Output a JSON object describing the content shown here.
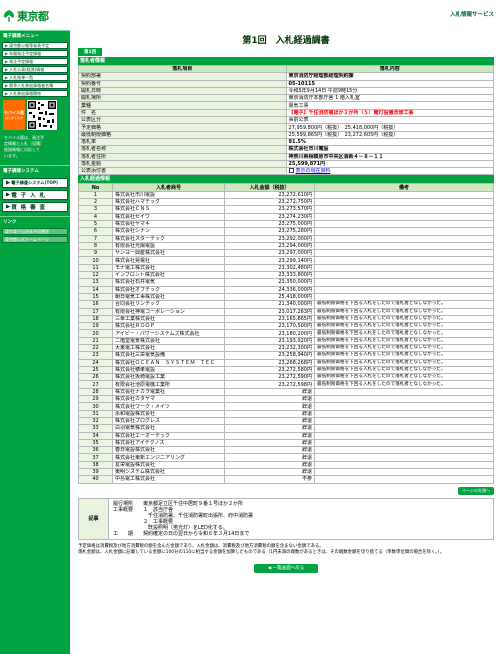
{
  "header": {
    "logo_text": "東京都",
    "right_link": "入札情報サービス"
  },
  "sidebar": {
    "menu_heading": "電子調達メニュー",
    "menu_items": [
      "東京都公報等発表予定",
      "年間発注予定情報",
      "発注予定情報",
      "入札公表(経過)情報",
      "入札結果一覧",
      "競争入札参加資格者名簿",
      "入札参加資格関係"
    ],
    "mobile_label": "モバイル版",
    "mobile_sub": "はじめての方",
    "mobile_text": [
      "モバイル版は、発注予",
      "定情報と入札（見積）",
      "経過情報に対応して",
      "います。"
    ],
    "system_heading": "電子調達システム",
    "big_items": [
      "電子調達システム(TOP)",
      "電 子 入 札",
      "資 格 審 査"
    ],
    "links_heading": "リンク",
    "links": [
      "東京電子自治体共同運営",
      "東京都公式ホームページ"
    ]
  },
  "main": {
    "title": "第1回　入札経過調書",
    "tab_label": "第1回",
    "section_info": "落札者情報",
    "info_header": [
      "落札項目",
      "落札内容"
    ],
    "info_rows": [
      {
        "label": "契約部署",
        "value": "東京消防庁経理部経理契約課",
        "style": "bold"
      },
      {
        "label": "契約番号",
        "value": "05-10115",
        "style": "bold"
      },
      {
        "label": "開札日時",
        "value": "令和5年9月14日 午前9時15分",
        "style": ""
      },
      {
        "label": "開札場所",
        "value": "東京消防庁本部庁舎 1 階入札室",
        "style": ""
      },
      {
        "label": "業種",
        "value": "電気工事",
        "style": ""
      },
      {
        "label": "件　名",
        "value": "【電子】千住消防署ほか２か所（５）電灯設備改修工事",
        "style": "red"
      },
      {
        "label": "公表区分",
        "value": "事前公表",
        "style": ""
      },
      {
        "label": "予定価格",
        "value": "27,959,800円（税抜）　25,418,000円（税抜）",
        "style": ""
      },
      {
        "label": "最低制限価格",
        "value": "25,599,865円（税抜）　23,272,605円（税抜）",
        "style": ""
      },
      {
        "label": "落札率",
        "value": "91.5%",
        "style": "bold"
      },
      {
        "label": "落札者名称",
        "value": "株式会社市川電設",
        "style": "bold"
      },
      {
        "label": "落札者住所",
        "value": "神奈川県相模原市中央区清新４－８－１１",
        "style": "bold"
      },
      {
        "label": "落札金額",
        "value": "25,599,871円",
        "style": "bold"
      },
      {
        "label": "公表添付書",
        "value": "表示の現在資料",
        "style": ""
      }
    ],
    "section_results": "入札経過情報",
    "results_header": [
      "No",
      "入札者商号",
      "入札金額（税抜）",
      "備考"
    ],
    "results": [
      {
        "no": "1",
        "name": "株式会社市川電設",
        "amount": "23,272,610円",
        "remark": ""
      },
      {
        "no": "2",
        "name": "株式会社ハマテック",
        "amount": "23,272,750円",
        "remark": ""
      },
      {
        "no": "3",
        "name": "株式会社ＣＮＳ",
        "amount": "23,273,570円",
        "remark": ""
      },
      {
        "no": "4",
        "name": "株式会社セイワ",
        "amount": "23,274,230円",
        "remark": ""
      },
      {
        "no": "5",
        "name": "株式会社ヤマキ",
        "amount": "23,275,000円",
        "remark": ""
      },
      {
        "no": "6",
        "name": "株式会社シナン",
        "amount": "23,275,280円",
        "remark": ""
      },
      {
        "no": "7",
        "name": "株式会社スターテック",
        "amount": "23,292,000円",
        "remark": ""
      },
      {
        "no": "8",
        "name": "有限会社光陽電設",
        "amount": "23,294,000円",
        "remark": ""
      },
      {
        "no": "9",
        "name": "サンヨー興産株式会社",
        "amount": "23,297,000円",
        "remark": ""
      },
      {
        "no": "10",
        "name": "株式会社晃電社",
        "amount": "23,299,140円",
        "remark": ""
      },
      {
        "no": "11",
        "name": "モナ電工株式会社",
        "amount": "23,302,480円",
        "remark": ""
      },
      {
        "no": "12",
        "name": "インフロント株式会社",
        "amount": "23,333,800円",
        "remark": ""
      },
      {
        "no": "13",
        "name": "株式会社石井電気",
        "amount": "23,350,000円",
        "remark": ""
      },
      {
        "no": "14",
        "name": "株式会社オブテック",
        "amount": "24,336,000円",
        "remark": ""
      },
      {
        "no": "15",
        "name": "朝日電気工事株式会社",
        "amount": "25,418,000円",
        "remark": ""
      },
      {
        "no": "16",
        "name": "合同会社リンテック",
        "amount": "21,340,000円",
        "remark": "最低制限価格を下回る入札をしたので落札者となしなかった。"
      },
      {
        "no": "17",
        "name": "有限会社神電コーポレーション",
        "amount": "23,017,263円",
        "remark": "最低制限価格を下回る入札をしたので落札者となしなかった。"
      },
      {
        "no": "18",
        "name": "三幸工業株式会社",
        "amount": "23,165,865円",
        "remark": "最低制限価格を下回る入札をしたので落札者となしなかった。"
      },
      {
        "no": "19",
        "name": "株式会社ＲＯＯＰ",
        "amount": "23,170,500円",
        "remark": "最低制限価格を下回る入札をしたので落札者となしなかった。"
      },
      {
        "no": "20",
        "name": "アイビー・パワーシステムズ株式会社",
        "amount": "23,180,200円",
        "remark": "最低制限価格を下回る入札をしたので落札者となしなかった。"
      },
      {
        "no": "21",
        "name": "二階堂電気株式会社",
        "amount": "23,193,920円",
        "remark": "最低制限価格を下回る入札をしたので落札者となしなかった。"
      },
      {
        "no": "22",
        "name": "大東電工株式会社",
        "amount": "23,232,300円",
        "remark": "最低制限価格を下回る入札をしたので落札者となしなかった。"
      },
      {
        "no": "23",
        "name": "株式会社三栄電気設備",
        "amount": "23,258,940円",
        "remark": "最低制限価格を下回る入札をしたので落札者となしなかった。"
      },
      {
        "no": "24",
        "name": "株式会社ＯＣＥＡＮ　ＳＹＳＴＥＭ　ＴＥＣ",
        "amount": "23,268,268円",
        "remark": "最低制限価格を下回る入札をしたので落札者となしなかった。"
      },
      {
        "no": "25",
        "name": "株式会社穂孝電設",
        "amount": "23,272,580円",
        "remark": "最低制限価格を下回る入札をしたので落札者となしなかった。"
      },
      {
        "no": "26",
        "name": "株式会社坂崎電設工業",
        "amount": "23,272,590円",
        "remark": "最低制限価格を下回る入札をしたので落札者となしなかった。"
      },
      {
        "no": "27",
        "name": "有限会社池原電機工業所",
        "amount": "23,272,598円",
        "remark": "最低制限価格を下回る入札をしたので落札者となしなかった。"
      },
      {
        "no": "28",
        "name": "株式会社ナカヲ電業社",
        "amount": "辞退",
        "remark": ""
      },
      {
        "no": "29",
        "name": "株式会社カタヤマ",
        "amount": "辞退",
        "remark": ""
      },
      {
        "no": "30",
        "name": "株式会社ワーク・メイツ",
        "amount": "辞退",
        "remark": ""
      },
      {
        "no": "31",
        "name": "永和電設株式会社",
        "amount": "辞退",
        "remark": ""
      },
      {
        "no": "32",
        "name": "株式会社プログレス",
        "amount": "辞退",
        "remark": ""
      },
      {
        "no": "33",
        "name": "白羽電気株式会社",
        "amount": "辞退",
        "remark": ""
      },
      {
        "no": "34",
        "name": "株式会社エーオーテック",
        "amount": "辞退",
        "remark": ""
      },
      {
        "no": "35",
        "name": "株式会社アイテクノス",
        "amount": "辞退",
        "remark": ""
      },
      {
        "no": "36",
        "name": "春日電設株式会社",
        "amount": "辞退",
        "remark": ""
      },
      {
        "no": "37",
        "name": "株式会社東新エンジニアリング",
        "amount": "辞退",
        "remark": ""
      },
      {
        "no": "38",
        "name": "友栄電設株式会社",
        "amount": "辞退",
        "remark": ""
      },
      {
        "no": "39",
        "name": "東明システム株式会社",
        "amount": "辞退",
        "remark": ""
      },
      {
        "no": "40",
        "name": "中島電工株式会社",
        "amount": "不参",
        "remark": ""
      }
    ],
    "page_top_label": "ページの先頭へ",
    "notes_label": "記事",
    "notes_lines": [
      "履行場所　　東京都足立区千住中居町９番１号ほか２か所",
      "工事概要　　１　該当庁舎",
      "　　　　　　　千住消防署、千住消防署町出張所、府中消防署",
      "　　　　　　２　工事概要",
      "　　　　　　　既設照明（蛍光灯）をLED化する。",
      "工　　期　　契約確定の日の翌日から令和６年３月14日まで"
    ],
    "footnotes": [
      "予定価格は消費税及び地方消費税の額を含んだ金額であり、入札金額は、消費税及び地方消費税の額を含まない金額である。",
      "落札金額は、入札金額に記載している金額に100分の110に相当する金額を加算したものである（1円未満の端数があるときは、その端数金額を切り捨てる（単数単位間の場合を除く。）。"
    ],
    "back_label": "一覧画面へ戻る"
  },
  "colors": {
    "brand_green": "#00a33f",
    "title_red": "#ff0000",
    "mobile_orange": "#ff6d00"
  }
}
